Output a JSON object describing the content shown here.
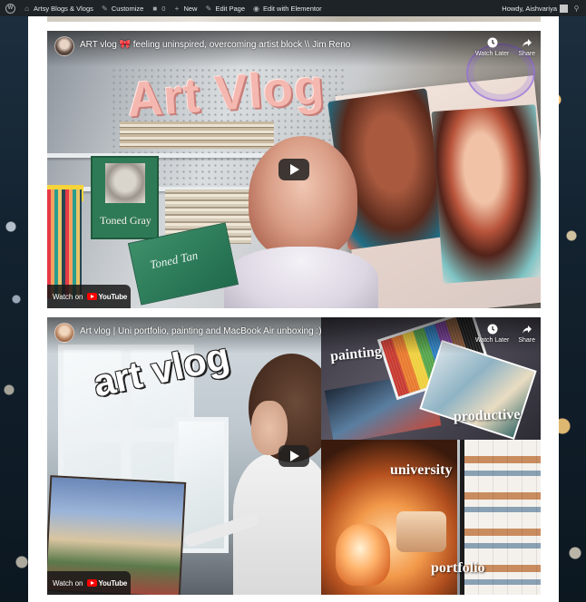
{
  "adminbar": {
    "site_name": "Artsy Blogs & Vlogs",
    "customize": "Customize",
    "comments_count": "0",
    "new": "New",
    "edit_page": "Edit Page",
    "edit_with_elementor": "Edit with Elementor",
    "greeting": "Howdy, Aishvariya"
  },
  "videos": [
    {
      "title": "ART vlog 🎀 feeling uninspired, overcoming artist block \\\\ Jim Reno",
      "thumbnail_text": "Art Vlog",
      "watch_later": "Watch Later",
      "share": "Share",
      "watch_on": "Watch on",
      "youtube": "YouTube",
      "sketchbook_label": "Toned Gray",
      "green_book_label": "Toned Tan"
    },
    {
      "title": "Art vlog | Uni portfolio, painting and MacBook Air unboxing :)",
      "thumbnail_text": "art vlog",
      "watch_later": "Watch Later",
      "share": "Share",
      "watch_on": "Watch on",
      "youtube": "YouTube",
      "captions": [
        "painting",
        "productive",
        "university",
        "portfolio"
      ]
    }
  ],
  "colors": {
    "adminbar_bg": "#1d2327",
    "youtube_red": "#ff0000"
  }
}
